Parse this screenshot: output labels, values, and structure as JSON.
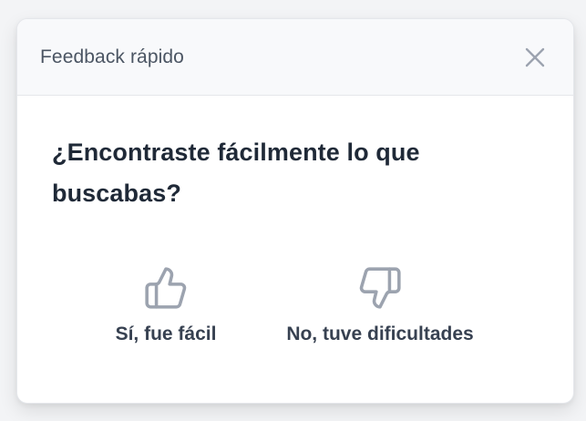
{
  "header": {
    "title": "Feedback rápido",
    "close_icon": "close-icon"
  },
  "question": "¿Encontraste fácilmente lo que buscabas?",
  "options": [
    {
      "label": "Sí, fue fácil",
      "icon": "thumbs-up-icon"
    },
    {
      "label": "No, tuve dificultades",
      "icon": "thumbs-down-icon"
    }
  ],
  "colors": {
    "icon_gray": "#9ca3af",
    "text_dark": "#1f2937",
    "header_bg": "#f8f9fb"
  }
}
